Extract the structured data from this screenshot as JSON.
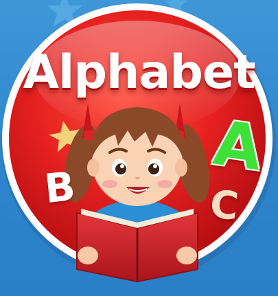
{
  "title": "Alphabet",
  "letters": {
    "a": "A",
    "b": "B",
    "c": "C"
  },
  "icons": {
    "girl": "girl-reading-book-illustration",
    "star": "star-icon",
    "book": "red-book-icon"
  },
  "colors": {
    "background": "#3f97d8",
    "badge_red": "#e4201f",
    "badge_border": "#ffffff",
    "title_text": "#ffffff",
    "letter_a": "#3fe03a",
    "letter_b": "#ffffff",
    "letter_c": "#f6ddc1",
    "star": "#f2d27a",
    "book_red": "#d8232a",
    "hair": "#8a4a2a",
    "shirt": "#2b8fd6"
  }
}
